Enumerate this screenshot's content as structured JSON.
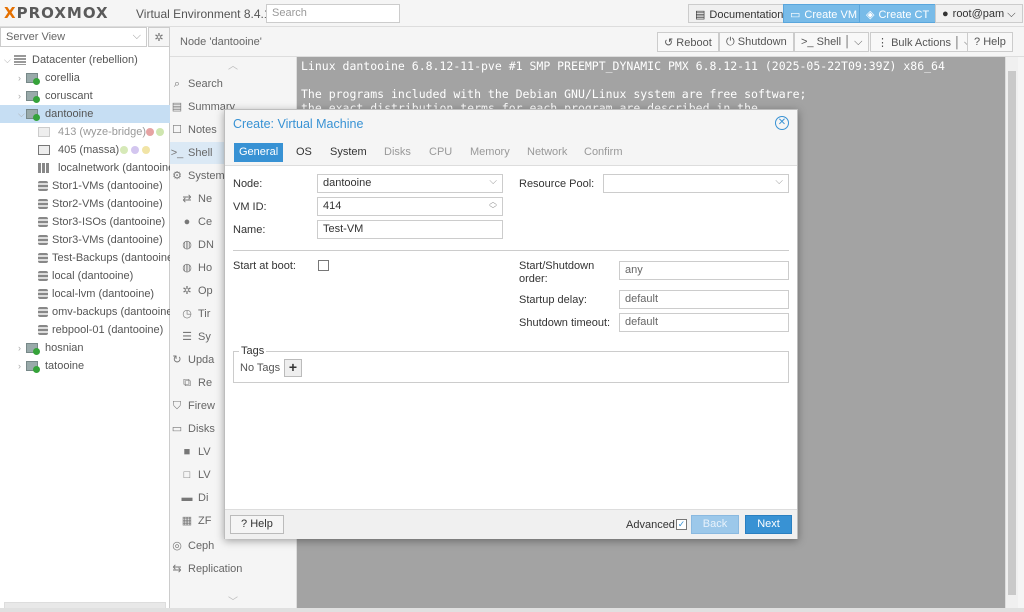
{
  "topbar": {
    "logo_prefix": "X",
    "logo_text": "PROXMOX",
    "version": "Virtual Environment 8.4.1",
    "search_placeholder": "Search",
    "documentation": "Documentation",
    "create_vm": "Create VM",
    "create_ct": "Create CT",
    "user": "root@pam"
  },
  "left": {
    "view": "Server View",
    "tree": [
      {
        "label": "Datacenter (rebellion)",
        "icon": "datacenter-icon"
      },
      {
        "label": "corellia",
        "icon": "server-icon"
      },
      {
        "label": "coruscant",
        "icon": "server-icon"
      },
      {
        "label": "dantooine",
        "icon": "server-icon"
      },
      {
        "label": "413 (wyze-bridge)",
        "icon": "container-icon"
      },
      {
        "label": "405 (massa)",
        "icon": "vm-icon"
      },
      {
        "label": "localnetwork (dantooine)",
        "icon": "network-icon"
      },
      {
        "label": "Stor1-VMs (dantooine)",
        "icon": "storage-icon"
      },
      {
        "label": "Stor2-VMs (dantooine)",
        "icon": "storage-icon"
      },
      {
        "label": "Stor3-ISOs (dantooine)",
        "icon": "storage-icon"
      },
      {
        "label": "Stor3-VMs (dantooine)",
        "icon": "storage-icon"
      },
      {
        "label": "Test-Backups (dantooine)",
        "icon": "storage-icon"
      },
      {
        "label": "local (dantooine)",
        "icon": "storage-icon"
      },
      {
        "label": "local-lvm (dantooine)",
        "icon": "storage-icon"
      },
      {
        "label": "omv-backups (dantooine)",
        "icon": "storage-icon"
      },
      {
        "label": "rebpool-01 (dantooine)",
        "icon": "storage-icon"
      },
      {
        "label": "hosnian",
        "icon": "server-icon"
      },
      {
        "label": "tatooine",
        "icon": "server-icon"
      }
    ]
  },
  "header": {
    "breadcrumb": "Node 'dantooine'",
    "reboot": "Reboot",
    "shutdown": "Shutdown",
    "shell": "Shell",
    "bulk_actions": "Bulk Actions",
    "help": "Help"
  },
  "nav": [
    {
      "label": "Search",
      "icon": "search-icon"
    },
    {
      "label": "Summary",
      "icon": "summary-icon"
    },
    {
      "label": "Notes",
      "icon": "notes-icon"
    },
    {
      "label": "Shell",
      "icon": "terminal-icon"
    },
    {
      "label": "System",
      "icon": "cogs-icon"
    },
    {
      "label": "Ne",
      "icon": "exchange-icon"
    },
    {
      "label": "Ce",
      "icon": "certificate-icon"
    },
    {
      "label": "DN",
      "icon": "globe-icon"
    },
    {
      "label": "Ho",
      "icon": "globe-icon"
    },
    {
      "label": "Op",
      "icon": "gear-icon"
    },
    {
      "label": "Tir",
      "icon": "clock-icon"
    },
    {
      "label": "Sy",
      "icon": "list-icon"
    },
    {
      "label": "Upda",
      "icon": "refresh-icon"
    },
    {
      "label": "Re",
      "icon": "files-icon"
    },
    {
      "label": "Firew",
      "icon": "shield-icon"
    },
    {
      "label": "Disks",
      "icon": "hdd-icon"
    },
    {
      "label": "LV",
      "icon": "square-icon"
    },
    {
      "label": "LV",
      "icon": "square-outline-icon"
    },
    {
      "label": "Di",
      "icon": "folder-icon"
    },
    {
      "label": "ZF",
      "icon": "th-icon"
    },
    {
      "label": "Ceph",
      "icon": "ceph-icon"
    },
    {
      "label": "Replication",
      "icon": "retweet-icon"
    }
  ],
  "terminal": {
    "lines": [
      "Linux dantooine 6.8.12-11-pve #1 SMP PREEMPT_DYNAMIC PMX 6.8.12-11 (2025-05-22T09:39Z) x86_64",
      "",
      "The programs included with the Debian GNU/Linux system are free software;",
      "the exact distribution terms for each program are described in the"
    ]
  },
  "modal": {
    "title": "Create: Virtual Machine",
    "tabs": [
      "General",
      "OS",
      "System",
      "Disks",
      "CPU",
      "Memory",
      "Network",
      "Confirm"
    ],
    "node_label": "Node:",
    "node_value": "dantooine",
    "vmid_label": "VM ID:",
    "vmid_value": "414",
    "name_label": "Name:",
    "name_value": "Test-VM",
    "pool_label": "Resource Pool:",
    "pool_value": "",
    "start_boot_label": "Start at boot:",
    "order_label_1": "Start/Shutdown",
    "order_label_2": "order:",
    "order_value": "any",
    "startup_delay_label": "Startup delay:",
    "startup_delay_value": "default",
    "shutdown_timeout_label": "Shutdown timeout:",
    "shutdown_timeout_value": "default",
    "tags_label": "Tags",
    "no_tags": "No Tags",
    "help": "Help",
    "advanced": "Advanced",
    "back": "Back",
    "next": "Next"
  },
  "colors": {
    "accent": "#3892d4",
    "logo_orange": "#e57000",
    "terminal_bg": "#a3a3a3"
  }
}
